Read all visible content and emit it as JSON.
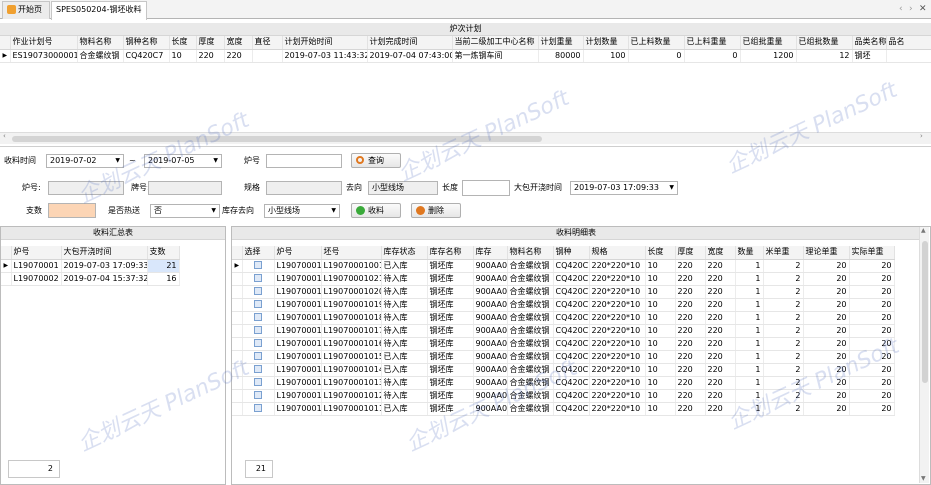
{
  "tabs": [
    {
      "label": "开始页"
    },
    {
      "label": "SPES050204-钢坯收料"
    }
  ],
  "plan": {
    "title": "炉次计划",
    "columns": [
      "作业计划号",
      "物料名称",
      "钢种名称",
      "长度",
      "厚度",
      "宽度",
      "直径",
      "计划开始时间",
      "计划完成时间",
      "当前二级加工中心名称",
      "计划重量",
      "计划数量",
      "已上料数量",
      "已上料重量",
      "已组批重量",
      "已组批数量",
      "品类名称",
      "品名"
    ],
    "rows": [
      [
        "ES19073000001",
        "合金螺纹钢",
        "CQ420C7",
        "10",
        "220",
        "220",
        "",
        "2019-07-03 11:43:32",
        "2019-07-04 07:43:00",
        "第一炼钢车间",
        "80000",
        "100",
        "0",
        "0",
        "1200",
        "12",
        "钢坯",
        ""
      ]
    ]
  },
  "form": {
    "recv_time_label": "收料时间",
    "date_from": "2019-07-02",
    "tilde": "~",
    "date_to": "2019-07-05",
    "heat_label": "炉号",
    "heat_value": "",
    "query_label": "查询",
    "heat2_label": "炉号:",
    "heat2_value": "",
    "brand_label": "牌号:",
    "brand_value": "",
    "spec_label": "规格",
    "spec_value": "",
    "dest_label": "去向",
    "dest_value": "小型线场",
    "len_label": "长度",
    "len_value": "",
    "ladle_label": "大包开浇时间",
    "ladle_value": "2019-07-03 17:09:33",
    "count_label": "支数",
    "count_value": "",
    "hot_label": "是否热送",
    "hot_value": "否",
    "storage_label": "库存去向",
    "storage_value": "小型线场",
    "receive_label": "收料",
    "delete_label": "删除"
  },
  "summary": {
    "title": "收料汇总表",
    "columns": [
      "炉号",
      "大包开浇时间",
      "支数"
    ],
    "rows": [
      [
        "L19070001",
        "2019-07-03 17:09:33",
        "21"
      ],
      [
        "L19070002",
        "2019-07-04 15:37:32",
        "16"
      ]
    ],
    "total": "2"
  },
  "detail": {
    "title": "收料明细表",
    "columns": [
      "选择",
      "炉号",
      "坯号",
      "库存状态",
      "库存名称",
      "库存",
      "物料名称",
      "钢种",
      "规格",
      "长度",
      "厚度",
      "宽度",
      "数量",
      "米单重",
      "理论单重",
      "实际单重"
    ],
    "rows": [
      [
        "",
        "L19070001",
        "L19070001001",
        "已入库",
        "钢坯库",
        "900AA0",
        "合金螺纹钢",
        "CQ420C7",
        "220*220*10",
        "10",
        "220",
        "220",
        "1",
        "2",
        "20",
        "20"
      ],
      [
        "",
        "L19070001",
        "L19070001021",
        "待入库",
        "钢坯库",
        "900AA0",
        "合金螺纹钢",
        "CQ420C7",
        "220*220*10",
        "10",
        "220",
        "220",
        "1",
        "2",
        "20",
        "20"
      ],
      [
        "",
        "L19070001",
        "L19070001020",
        "待入库",
        "钢坯库",
        "900AA0",
        "合金螺纹钢",
        "CQ420C7",
        "220*220*10",
        "10",
        "220",
        "220",
        "1",
        "2",
        "20",
        "20"
      ],
      [
        "",
        "L19070001",
        "L19070001019",
        "待入库",
        "钢坯库",
        "900AA0",
        "合金螺纹钢",
        "CQ420C7",
        "220*220*10",
        "10",
        "220",
        "220",
        "1",
        "2",
        "20",
        "20"
      ],
      [
        "",
        "L19070001",
        "L19070001018",
        "待入库",
        "钢坯库",
        "900AA0",
        "合金螺纹钢",
        "CQ420C7",
        "220*220*10",
        "10",
        "220",
        "220",
        "1",
        "2",
        "20",
        "20"
      ],
      [
        "",
        "L19070001",
        "L19070001017",
        "待入库",
        "钢坯库",
        "900AA0",
        "合金螺纹钢",
        "CQ420C7",
        "220*220*10",
        "10",
        "220",
        "220",
        "1",
        "2",
        "20",
        "20"
      ],
      [
        "",
        "L19070001",
        "L19070001016",
        "待入库",
        "钢坯库",
        "900AA0",
        "合金螺纹钢",
        "CQ420C7",
        "220*220*10",
        "10",
        "220",
        "220",
        "1",
        "2",
        "20",
        "20"
      ],
      [
        "",
        "L19070001",
        "L19070001015",
        "已入库",
        "钢坯库",
        "900AA0",
        "合金螺纹钢",
        "CQ420C7",
        "220*220*10",
        "10",
        "220",
        "220",
        "1",
        "2",
        "20",
        "20"
      ],
      [
        "",
        "L19070001",
        "L19070001014",
        "已入库",
        "钢坯库",
        "900AA0",
        "合金螺纹钢",
        "CQ420C7",
        "220*220*10",
        "10",
        "220",
        "220",
        "1",
        "2",
        "20",
        "20"
      ],
      [
        "",
        "L19070001",
        "L19070001013",
        "待入库",
        "钢坯库",
        "900AA0",
        "合金螺纹钢",
        "CQ420C7",
        "220*220*10",
        "10",
        "220",
        "220",
        "1",
        "2",
        "20",
        "20"
      ],
      [
        "",
        "L19070001",
        "L19070001012",
        "待入库",
        "钢坯库",
        "900AA0",
        "合金螺纹钢",
        "CQ420C7",
        "220*220*10",
        "10",
        "220",
        "220",
        "1",
        "2",
        "20",
        "20"
      ],
      [
        "",
        "L19070001",
        "L19070001011",
        "已入库",
        "钢坯库",
        "900AA0",
        "合金螺纹钢",
        "CQ420C7",
        "220*220*10",
        "10",
        "220",
        "220",
        "1",
        "2",
        "20",
        "20"
      ]
    ],
    "total": "21"
  },
  "watermark": "企划云天 PlanSoft"
}
